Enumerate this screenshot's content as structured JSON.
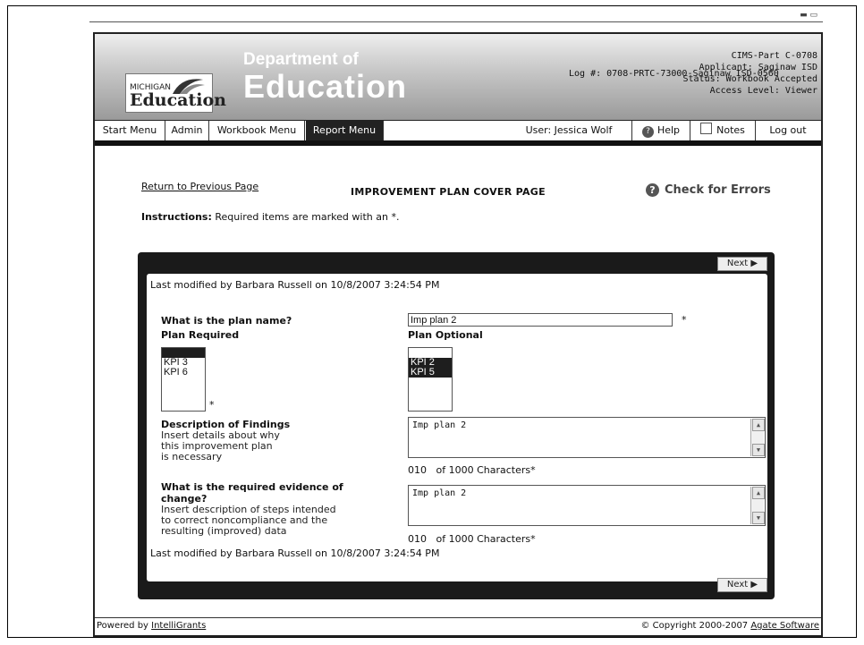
{
  "header": {
    "logo_small": "MICHIGAN",
    "logo_text": "Education",
    "dept_line1": "Department of",
    "dept_line2": "Education",
    "log_number": "Log #: 0708-PRTC-73000-Saginaw ISD-0560",
    "info_lines": [
      "CIMS-Part C-0708",
      "Applicant: Saginaw ISD",
      "Status: Workbook Accepted",
      "Access Level: Viewer"
    ]
  },
  "nav": {
    "start": "Start Menu",
    "admin": "Admin",
    "workbook": "Workbook Menu",
    "report": "Report Menu",
    "user": "User: Jessica Wolf",
    "help": "Help",
    "notes": "Notes",
    "logout": "Log out"
  },
  "page": {
    "return_link": "Return to Previous Page",
    "title": "IMPROVEMENT PLAN COVER PAGE",
    "check_errors": "Check for Errors",
    "instructions_label": "Instructions:",
    "instructions_text": "Required items are marked with an *."
  },
  "form": {
    "next_label": "Next ▶",
    "last_modified": "Last modified by Barbara Russell on 10/8/2007 3:24:54 PM",
    "plan_name_label": "What is the plan name?",
    "plan_name_value": "Imp plan 2",
    "required_star": "*",
    "plan_required_label": "Plan Required",
    "plan_required_options": [
      "KPI 3",
      "KPI 6"
    ],
    "plan_optional_label": "Plan Optional",
    "plan_optional_options": [
      "KPI 2",
      "KPI 5"
    ],
    "findings_label": "Description of Findings",
    "findings_help": [
      "Insert details about why",
      "this improvement plan",
      "is necessary"
    ],
    "findings_value": "Imp plan 2",
    "findings_count": "010",
    "findings_count_text": "of 1000 Characters*",
    "evidence_label_1": "What is the required evidence of",
    "evidence_label_2": "change?",
    "evidence_help": [
      "Insert description of steps intended",
      "to correct noncompliance and the",
      "resulting (improved) data"
    ],
    "evidence_value": "Imp plan 2",
    "evidence_count": "010",
    "evidence_count_text": "of 1000 Characters*"
  },
  "footer": {
    "powered_prefix": "Powered by ",
    "powered_link": "IntelliGrants",
    "copyright_prefix": "© Copyright 2000-2007 ",
    "copyright_link": "Agate Software"
  }
}
